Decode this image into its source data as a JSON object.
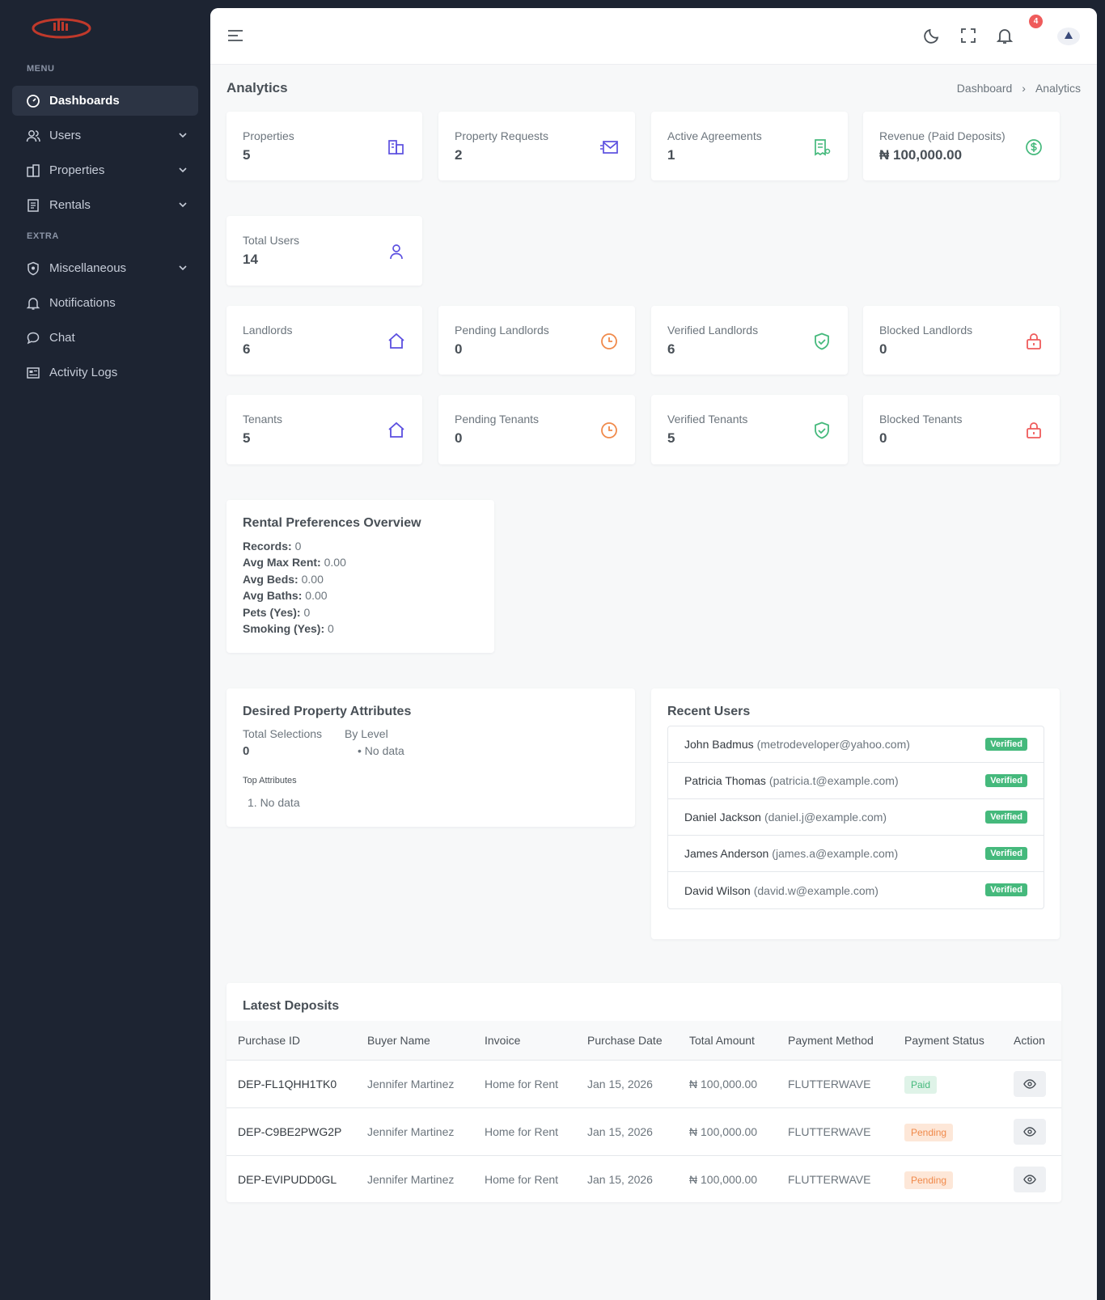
{
  "sidebar": {
    "menu_title": "MENU",
    "extra_title": "EXTRA",
    "items": [
      {
        "label": "Dashboards"
      },
      {
        "label": "Users"
      },
      {
        "label": "Properties"
      },
      {
        "label": "Rentals"
      },
      {
        "label": "Miscellaneous"
      },
      {
        "label": "Notifications"
      },
      {
        "label": "Chat"
      },
      {
        "label": "Activity Logs"
      }
    ]
  },
  "topbar": {
    "notification_count": "4"
  },
  "page": {
    "title": "Analytics",
    "breadcrumb": [
      "Dashboard",
      "›",
      "Analytics"
    ]
  },
  "stats": {
    "properties": {
      "label": "Properties",
      "value": "5"
    },
    "property_requests": {
      "label": "Property Requests",
      "value": "2"
    },
    "active_agreements": {
      "label": "Active Agreements",
      "value": "1"
    },
    "revenue": {
      "label": "Revenue (Paid Deposits)",
      "value": "₦ 100,000.00"
    },
    "total_users": {
      "label": "Total Users",
      "value": "14"
    },
    "landlords": {
      "label": "Landlords",
      "value": "6"
    },
    "pending_landlords": {
      "label": "Pending Landlords",
      "value": "0"
    },
    "verified_landlords": {
      "label": "Verified Landlords",
      "value": "6"
    },
    "blocked_landlords": {
      "label": "Blocked Landlords",
      "value": "0"
    },
    "tenants": {
      "label": "Tenants",
      "value": "5"
    },
    "pending_tenants": {
      "label": "Pending Tenants",
      "value": "0"
    },
    "verified_tenants": {
      "label": "Verified Tenants",
      "value": "5"
    },
    "blocked_tenants": {
      "label": "Blocked Tenants",
      "value": "0"
    }
  },
  "colors": {
    "purple": "#5b4fe0",
    "orange": "#f08a4b",
    "green": "#45b97c",
    "red": "#ef5b5b"
  },
  "rental_prefs": {
    "title": "Rental Preferences Overview",
    "rows": [
      {
        "label": "Records:",
        "value": " 0"
      },
      {
        "label": "Avg Max Rent:",
        "value": " 0.00"
      },
      {
        "label": "Avg Beds:",
        "value": " 0.00"
      },
      {
        "label": "Avg Baths:",
        "value": " 0.00"
      },
      {
        "label": "Pets (Yes):",
        "value": " 0"
      },
      {
        "label": "Smoking (Yes):",
        "value": " 0"
      }
    ]
  },
  "desired_attrs": {
    "title": "Desired Property Attributes",
    "total_label": "Total Selections",
    "total_value": "0",
    "by_level_label": "By Level",
    "by_level_item": "No data",
    "top_label": "Top Attributes",
    "top_item": "1. No data"
  },
  "recent_users": {
    "title": "Recent Users",
    "items": [
      {
        "name": "John Badmus",
        "email": "(metrodeveloper@yahoo.com)",
        "status": "Verified"
      },
      {
        "name": "Patricia Thomas",
        "email": "(patricia.t@example.com)",
        "status": "Verified"
      },
      {
        "name": "Daniel Jackson",
        "email": "(daniel.j@example.com)",
        "status": "Verified"
      },
      {
        "name": "James Anderson",
        "email": "(james.a@example.com)",
        "status": "Verified"
      },
      {
        "name": "David Wilson",
        "email": "(david.w@example.com)",
        "status": "Verified"
      }
    ]
  },
  "deposits": {
    "title": "Latest Deposits",
    "columns": [
      "Purchase ID",
      "Buyer Name",
      "Invoice",
      "Purchase Date",
      "Total Amount",
      "Payment Method",
      "Payment Status",
      "Action"
    ],
    "rows": [
      {
        "id": "DEP-FL1QHH1TK0",
        "buyer": "Jennifer Martinez",
        "invoice": "Home for Rent",
        "date": "Jan 15, 2026",
        "amount": "₦ 100,000.00",
        "method": "FLUTTERWAVE",
        "status": "Paid"
      },
      {
        "id": "DEP-C9BE2PWG2P",
        "buyer": "Jennifer Martinez",
        "invoice": "Home for Rent",
        "date": "Jan 15, 2026",
        "amount": "₦ 100,000.00",
        "method": "FLUTTERWAVE",
        "status": "Pending"
      },
      {
        "id": "DEP-EVIPUDD0GL",
        "buyer": "Jennifer Martinez",
        "invoice": "Home for Rent",
        "date": "Jan 15, 2026",
        "amount": "₦ 100,000.00",
        "method": "FLUTTERWAVE",
        "status": "Pending"
      }
    ]
  }
}
